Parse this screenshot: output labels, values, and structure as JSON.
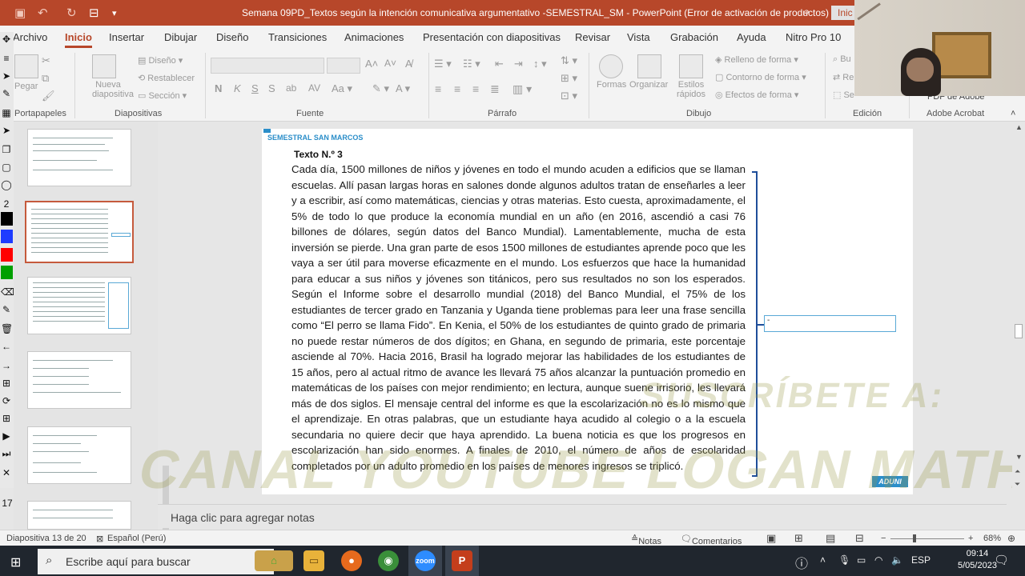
{
  "titlebar": {
    "title": "Semana 09PD_Textos según la intención comunicativa argumentativo -SEMESTRAL_SM  -  PowerPoint (Error de activación de productos)",
    "signin": "Inic"
  },
  "tabs": [
    "Archivo",
    "Inicio",
    "Insertar",
    "Dibujar",
    "Diseño",
    "Transiciones",
    "Animaciones",
    "Presentación con diapositivas",
    "Revisar",
    "Vista",
    "Grabación",
    "Ayuda",
    "Nitro Pro 10"
  ],
  "ribbon": {
    "groups": [
      "Portapapeles",
      "Diapositivas",
      "Fuente",
      "Párrafo",
      "Dibujo",
      "Edición",
      "Adobe Acrobat"
    ],
    "pegar": "Pegar",
    "nueva_diapositiva": "Nueva diapositiva",
    "diseno": "Diseño",
    "restablecer": "Restablecer",
    "seccion": "Sección",
    "formas": "Formas",
    "organizar": "Organizar",
    "estilos_rapidos": "Estilos rápidos",
    "relleno": "Relleno de forma",
    "contorno": "Contorno de forma",
    "efectos": "Efectos de forma",
    "pdf_adobe": "PDF de Adobe",
    "bu": "Bu",
    "re": "Re",
    "se": "Se"
  },
  "slide": {
    "header": "SEMESTRAL SAN MARCOS",
    "texto_label": "Texto N.º 3",
    "body": "Cada día, 1500 millones de niños y jóvenes en todo el mundo acuden a edificios que se llaman escuelas. Allí pasan largas horas en salones donde algunos adultos tratan de enseñarles a leer y a escribir, así como matemáticas, ciencias y otras materias. Esto cuesta, aproximadamente, el 5% de todo lo que produce la economía mundial en un año (en 2016, ascendió a casi 76 billones de dólares, según datos del Banco Mundial). Lamentablemente, mucha de esta inversión se pierde. Una gran parte de esos 1500 millones de estudiantes aprende poco que les vaya a ser útil para moverse eficazmente en el mundo. Los esfuerzos que hace la humanidad para educar a sus niños y jóvenes son titánicos, pero sus resultados no son los esperados. Según el Informe sobre el desarrollo mundial (2018) del Banco Mundial, el 75% de los estudiantes de tercer grado en Tanzania y Uganda tiene problemas para leer una frase sencilla como “El perro se llama Fido”. En Kenia, el 50% de los estudiantes de quinto grado de primaria no puede restar números de dos dígitos; en Ghana, en segundo de primaria, este porcentaje asciende al 70%. Hacia 2016, Brasil ha logrado mejorar las habilidades de los estudiantes de 15 años, pero al actual ritmo de avance les llevará 75 años alcanzar la puntuación promedio en matemáticas de los países con mejor rendimiento; en lectura, aunque suene irrisorio, les llevará más de dos siglos. El mensaje central del informe es que la escolarización no es lo mismo que el aprendizaje. En otras palabras, que un estudiante haya acudido al colegio o a la escuela secundaria no quiere decir que haya aprendido. La buena noticia es que los progresos en escolarización han sido enormes. A finales de 2010, el número de años de escolaridad completados por un adulto promedio en los países de menores ingresos se triplicó.",
    "answer_box": "-",
    "brand": "ADUNI",
    "watermark_line1": "SUSCRÍBETE A:",
    "watermark_line2": "CANAL YOUTUBE LOGAN MATHS"
  },
  "notes_placeholder": "Haga clic para agregar notas",
  "left_tool_number": "17",
  "statusbar": {
    "slide_counter": "Diapositiva 13 de 20",
    "language": "Español (Perú)",
    "notes": "Notas",
    "comments": "Comentarios",
    "zoom": "68%"
  },
  "taskbar": {
    "search_placeholder": "Escribe aquí para buscar",
    "lang": "ESP",
    "time": "09:14",
    "date": "5/05/2023"
  },
  "colors": {
    "accent": "#b7472a",
    "slide_blue": "#2b8ec9",
    "bracket": "#1f4e9a"
  }
}
